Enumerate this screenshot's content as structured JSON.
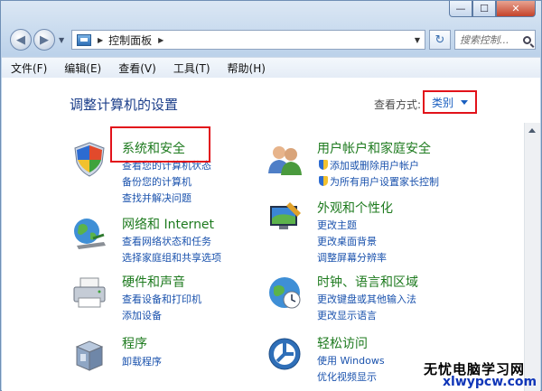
{
  "window": {
    "controls": [
      "—",
      "☐",
      "✕"
    ]
  },
  "navbar": {
    "address": "控制面板",
    "search_placeholder": "搜索控制..."
  },
  "menu": [
    "文件(F)",
    "编辑(E)",
    "查看(V)",
    "工具(T)",
    "帮助(H)"
  ],
  "content": {
    "title": "调整计算机的设置",
    "view_by_label": "查看方式:",
    "view_by_value": "类别"
  },
  "categories": [
    {
      "title": "系统和安全",
      "icon": "security-shield-icon",
      "links": [
        "查看您的计算机状态",
        "备份您的计算机",
        "查找并解决问题"
      ]
    },
    {
      "title": "用户帐户和家庭安全",
      "icon": "users-icon",
      "links": [
        "添加或删除用户帐户",
        "为所有用户设置家长控制"
      ]
    },
    {
      "title": "网络和 Internet",
      "icon": "network-globe-icon",
      "links": [
        "查看网络状态和任务",
        "选择家庭组和共享选项"
      ]
    },
    {
      "title": "外观和个性化",
      "icon": "appearance-monitor-icon",
      "links": [
        "更改主题",
        "更改桌面背景",
        "调整屏幕分辨率"
      ]
    },
    {
      "title": "硬件和声音",
      "icon": "printer-icon",
      "links": [
        "查看设备和打印机",
        "添加设备"
      ]
    },
    {
      "title": "时钟、语言和区域",
      "icon": "clock-globe-icon",
      "links": [
        "更改键盘或其他输入法",
        "更改显示语言"
      ]
    },
    {
      "title": "程序",
      "icon": "programs-box-icon",
      "links": [
        "卸载程序"
      ]
    },
    {
      "title": "轻松访问",
      "icon": "ease-of-access-icon",
      "links": [
        "使用 Windows",
        "优化视频显示"
      ]
    }
  ],
  "watermark": {
    "line1": "无忧电脑学习网",
    "line2": "xlwypcw.com"
  },
  "colors": {
    "highlight_box": "#e2121a",
    "category_title": "#1d7a1e",
    "link": "#1a52ad"
  }
}
